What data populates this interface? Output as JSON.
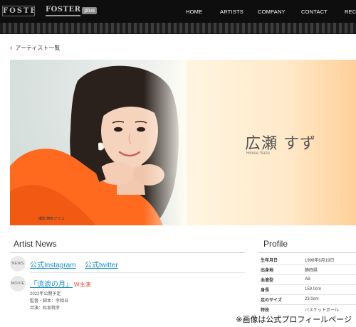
{
  "header": {
    "logo_left": "FOSTER",
    "logo_right_main": "FOSTER",
    "logo_right_plus": "plus",
    "nav": [
      "HOME",
      "ARTISTS",
      "COMPANY",
      "CONTACT",
      "RECR"
    ]
  },
  "back_link": {
    "label": "アーティスト一覧"
  },
  "hero": {
    "name_ja": "広瀬 すず",
    "name_en": "Hirose Suzu",
    "photo_credit": "撮影:榊田フミコ"
  },
  "news": {
    "title": "Artist News",
    "items": [
      {
        "badge": "NEWS",
        "links": [
          "公式Instagram",
          "公式twitter"
        ]
      },
      {
        "badge": "MOVIE",
        "title": "「流浪の月」",
        "role": "W主演",
        "details": [
          "2022年公開予定",
          "監督・脚本：李相日",
          "共演：松坂桃李"
        ]
      }
    ]
  },
  "profile": {
    "title": "Profile",
    "rows": [
      {
        "key": "生年月日",
        "value": "1998年6月19日"
      },
      {
        "key": "出身地",
        "value": "静岡県"
      },
      {
        "key": "血液型",
        "value": "AB"
      },
      {
        "key": "身長",
        "value": "159.0cm"
      },
      {
        "key": "足のサイズ",
        "value": "23.0cm"
      },
      {
        "key": "特技",
        "value": "バスケットボール"
      }
    ]
  },
  "caption": "※画像は公式プロフィールページ",
  "colors": {
    "link": "#1a8fc7",
    "role": "#e5483a",
    "header_bg": "#0e0e0e"
  }
}
